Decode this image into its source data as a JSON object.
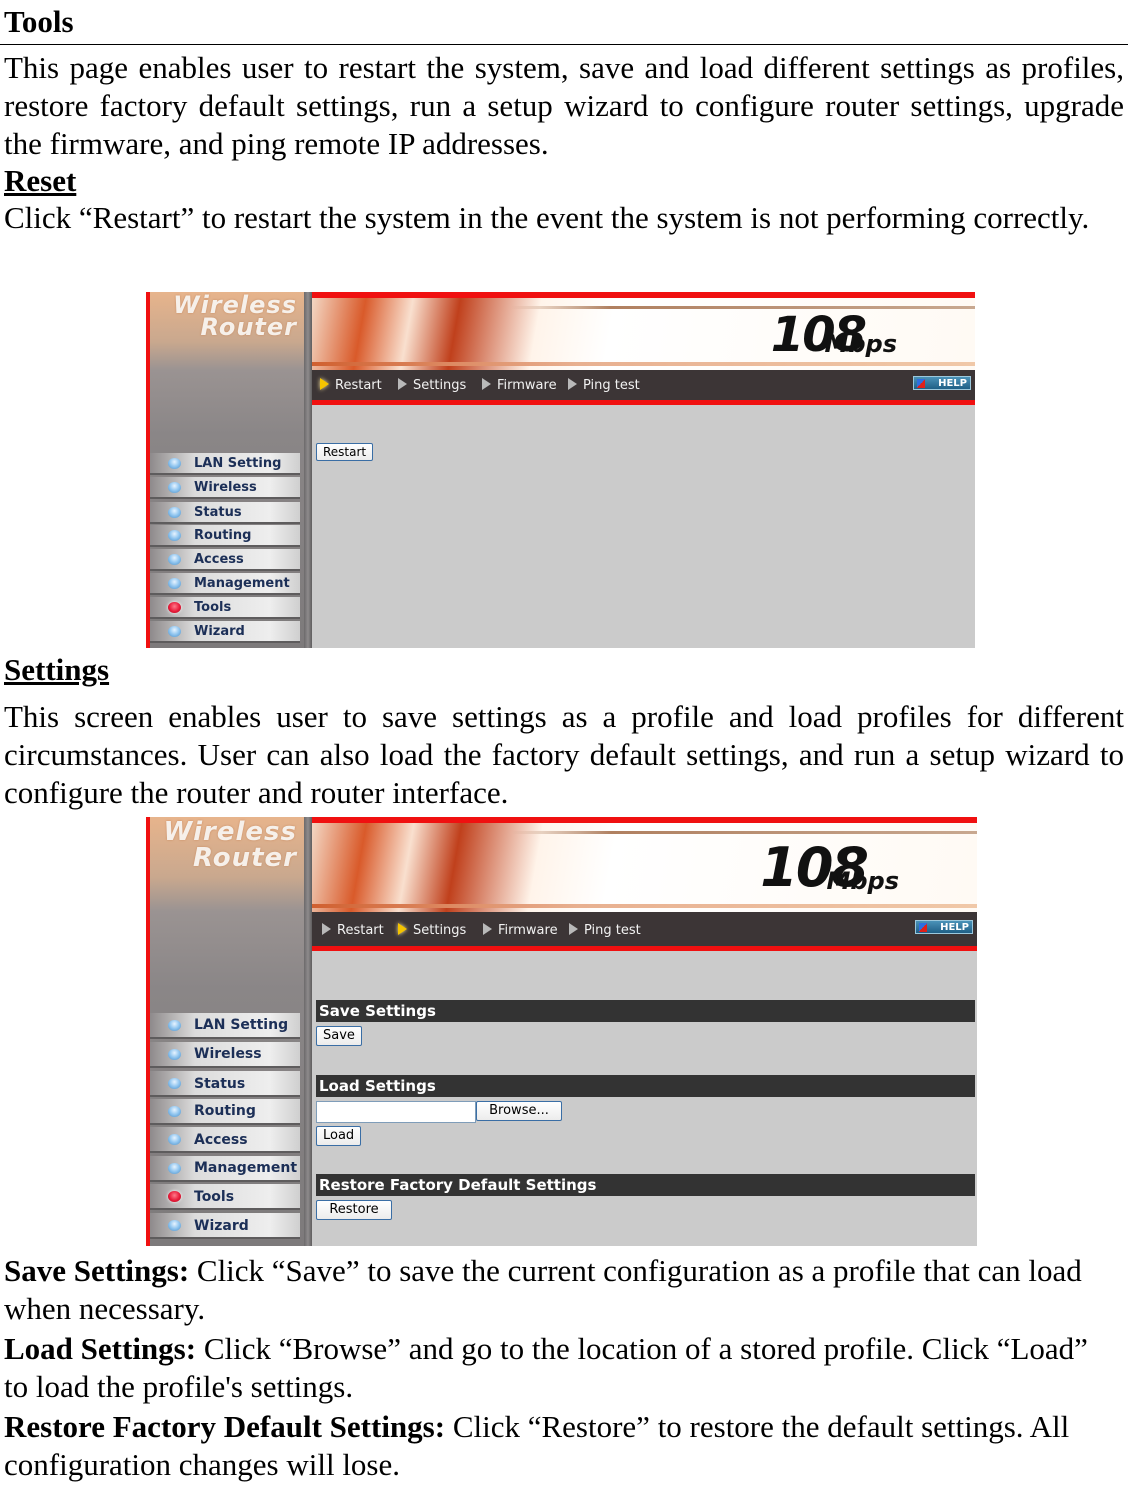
{
  "document": {
    "title": "Tools",
    "intro": "This page enables user to restart the system, save and load different settings as profiles, restore factory default settings, run a setup wizard to configure router settings, upgrade the firmware, and ping remote IP addresses.",
    "reset": {
      "heading": "Reset",
      "text": "Click “Restart” to restart the system in the event the system is not performing correctly."
    },
    "settings": {
      "heading": "Settings",
      "text": "This screen enables user to save settings as a profile and load profiles for different circumstances. User can also load the factory default settings, and run a setup wizard to configure the router and router interface."
    },
    "descriptions": [
      {
        "term": "Save Settings:",
        "text": " Click “Save” to save the current configuration as a profile that can load when necessary."
      },
      {
        "term": "Load Settings:",
        "text": " Click “Browse” and go to the location of a stored profile. Click “Load” to load the profile's settings."
      },
      {
        "term": "Restore Factory Default Settings:",
        "text": " Click “Restore” to restore the default settings. All configuration changes will lose."
      }
    ]
  },
  "router_ui": {
    "logo_line1": "Wireless",
    "logo_line2": "Router",
    "speed": "108",
    "speed_unit": "Mbps",
    "help_label": "HELP",
    "nav": [
      "Restart",
      "Settings",
      "Firmware",
      "Ping test"
    ],
    "menu": [
      "LAN Setting",
      "Wireless",
      "Status",
      "Routing",
      "Access",
      "Management",
      "Tools",
      "Wizard"
    ],
    "active_menu": "Tools",
    "colors": {
      "accent_red": "#f01010",
      "navbar": "#3c3536",
      "content_bg": "#cbcbcb"
    }
  },
  "screen1": {
    "active_nav": "Restart",
    "restart_button": "Restart"
  },
  "screen2": {
    "active_nav": "Settings",
    "save_heading": "Save Settings",
    "save_button": "Save",
    "load_heading": "Load Settings",
    "file_value": "",
    "browse_button": "Browse...",
    "load_button": "Load",
    "restore_heading": "Restore Factory Default Settings",
    "restore_button": "Restore"
  }
}
